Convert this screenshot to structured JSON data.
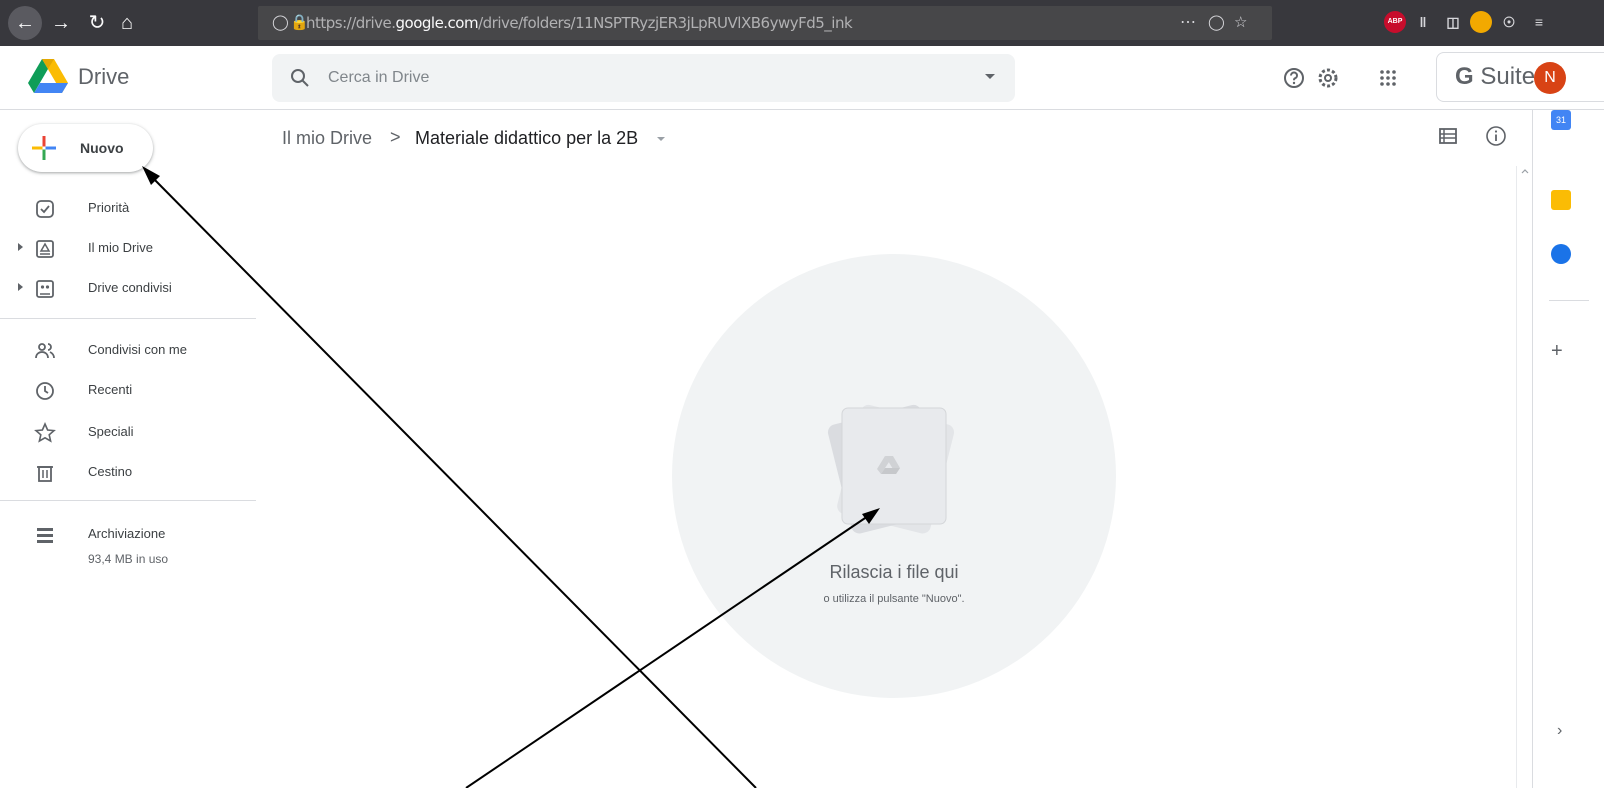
{
  "browser": {
    "url_prefix": "https://drive.",
    "url_domain": "google.com",
    "url_path": "/drive/folders/11NSPTRyzjER3jLpRUVlXB6ywyFd5_ink",
    "ext_abp": "ABP"
  },
  "header": {
    "app_name": "Drive",
    "search_placeholder": "Cerca in Drive",
    "gsuite_g": "G",
    "gsuite_label": " Suite",
    "avatar_initial": "N"
  },
  "sidebar": {
    "new_button": "Nuovo",
    "items": [
      {
        "label": "Priorità",
        "icon": "priority-icon"
      },
      {
        "label": "Il mio Drive",
        "icon": "my-drive-icon"
      },
      {
        "label": "Drive condivisi",
        "icon": "shared-drives-icon"
      },
      {
        "label": "Condivisi con me",
        "icon": "shared-with-me-icon"
      },
      {
        "label": "Recenti",
        "icon": "clock-icon"
      },
      {
        "label": "Speciali",
        "icon": "star-icon"
      },
      {
        "label": "Cestino",
        "icon": "trash-icon"
      },
      {
        "label": "Archiviazione",
        "icon": "storage-icon"
      }
    ],
    "storage_used": "93,4 MB in uso"
  },
  "breadcrumb": {
    "root": "Il mio Drive",
    "separator": ">",
    "current": "Materiale didattico per la 2B"
  },
  "empty_state": {
    "title": "Rilascia i file qui",
    "subtitle": "o utilizza il pulsante \"Nuovo\"."
  },
  "side_panel": {
    "calendar_label": "31"
  },
  "colors": {
    "chrome": "#38383d",
    "accent_blue": "#1a73e8",
    "avatar": "#d84315"
  }
}
